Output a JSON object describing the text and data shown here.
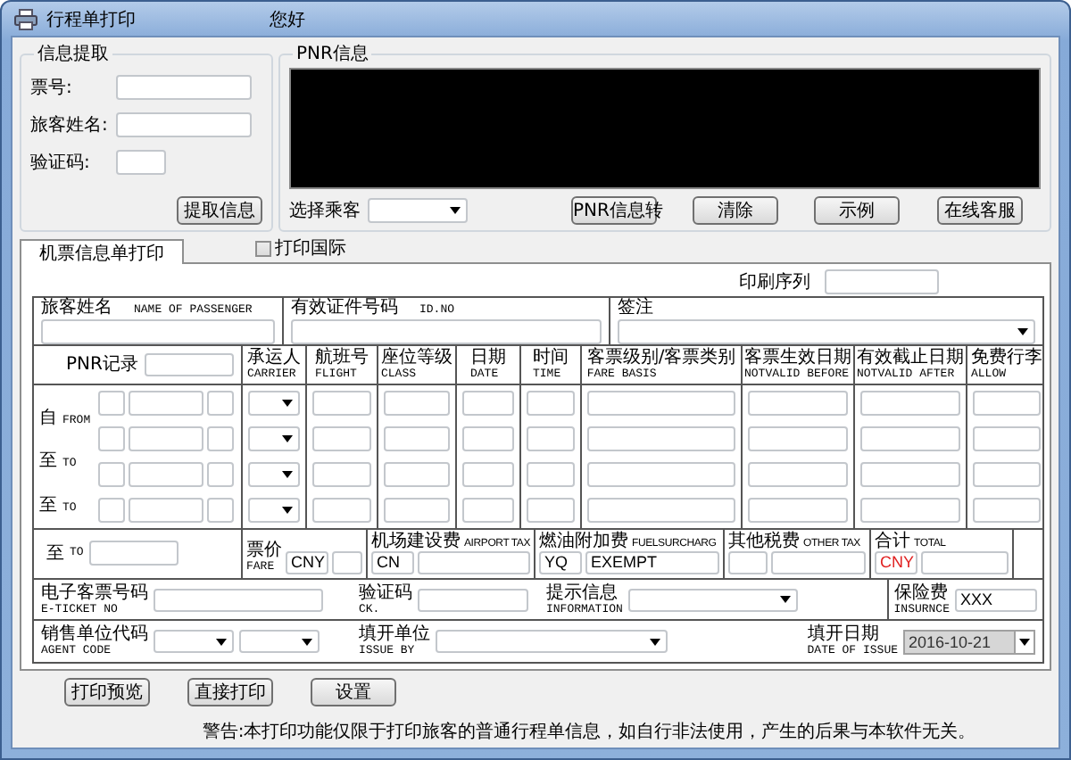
{
  "window": {
    "title": "行程单打印",
    "greeting": "您好"
  },
  "info_extract": {
    "title": "信息提取",
    "fields": [
      {
        "label": "票号:",
        "kind": "wide"
      },
      {
        "label": "旅客姓名:",
        "kind": "wide"
      },
      {
        "label": "验证码:",
        "kind": "short"
      }
    ],
    "button": "提取信息"
  },
  "pnr": {
    "title": "PNR信息",
    "passenger_label": "选择乘客",
    "buttons": [
      "PNR信息转",
      "清除",
      "示例",
      "在线客服"
    ]
  },
  "tabs": [
    {
      "label": "机票信息单打印",
      "selected": true
    }
  ],
  "print_international": {
    "label": "打印国际",
    "checked": false
  },
  "print_serial_label": "印刷序列",
  "passenger_row": [
    {
      "cn": "旅客姓名",
      "en": "NAME OF PASSENGER",
      "kind": "input"
    },
    {
      "cn": "有效证件号码",
      "en": "ID.NO",
      "kind": "input"
    },
    {
      "cn": "签注",
      "kind": "select"
    }
  ],
  "pnr_record": "PNR记录",
  "columns": [
    {
      "cn": "承运人",
      "en": "CARRIER",
      "kind": "select"
    },
    {
      "cn": "航班号",
      "en": "FLIGHT",
      "kind": "input"
    },
    {
      "cn": "座位等级",
      "en": "CLASS",
      "kind": "input"
    },
    {
      "cn": "日期",
      "en": "DATE",
      "kind": "input"
    },
    {
      "cn": "时间",
      "en": "TIME",
      "kind": "input"
    },
    {
      "cn": "客票级别/客票类别",
      "en": "FARE BASIS",
      "kind": "input"
    },
    {
      "cn": "客票生效日期",
      "en": "NOTVALID BEFORE",
      "kind": "input"
    },
    {
      "cn": "有效截止日期",
      "en": "NOTVALID AFTER",
      "kind": "input"
    },
    {
      "cn": "免费行李",
      "en": "ALLOW",
      "kind": "input"
    }
  ],
  "route_labels": [
    {
      "cn": "自",
      "en": "FROM"
    },
    {
      "cn": "至",
      "en": "TO"
    },
    {
      "cn": "至",
      "en": "TO"
    }
  ],
  "fare_row": {
    "route": {
      "cn": "至",
      "en": "TO"
    },
    "cells": [
      {
        "kind": "stacked",
        "cn": "票价",
        "en": "FARE",
        "code": "CNY",
        "color": "#000000"
      },
      {
        "kind": "inline",
        "cn": "机场建设费",
        "en": "AIRPORT TAX",
        "code": "CN",
        "color": "#000000"
      },
      {
        "kind": "inline",
        "cn": "燃油附加费",
        "en": "FUELSURCHARG",
        "code": "YQ",
        "color": "#000000",
        "value": "EXEMPT"
      },
      {
        "kind": "inline",
        "cn": "其他税费",
        "en": "OTHER TAX"
      },
      {
        "kind": "inline",
        "cn": "合计",
        "en": "TOTAL",
        "code": "CNY",
        "color": "#e02020"
      }
    ]
  },
  "ticket_row": [
    {
      "cn": "电子客票号码",
      "en": "E-TICKET NO",
      "kind": "input"
    },
    {
      "cn": "验证码",
      "en": "CK.",
      "kind": "input"
    },
    {
      "cn": "提示信息",
      "en": "INFORMATION",
      "kind": "select"
    },
    {
      "cn": "保险费",
      "en": "INSURNCE",
      "kind": "input",
      "value": "XXX"
    }
  ],
  "agent_row": [
    {
      "cn": "销售单位代码",
      "en": "AGENT CODE",
      "kind": "double_select"
    },
    {
      "cn": "填开单位",
      "en": "ISSUE BY",
      "kind": "select"
    },
    {
      "cn": "填开日期",
      "en": "DATE OF ISSUE",
      "kind": "date",
      "value": "2016-10-21",
      "disabled": true
    }
  ],
  "actions": [
    "打印预览",
    "直接打印",
    "设置"
  ],
  "warning": "警告:本打印功能仅限于打印旅客的普通行程单信息，如自行非法使用，产生的后果与本软件无关。"
}
